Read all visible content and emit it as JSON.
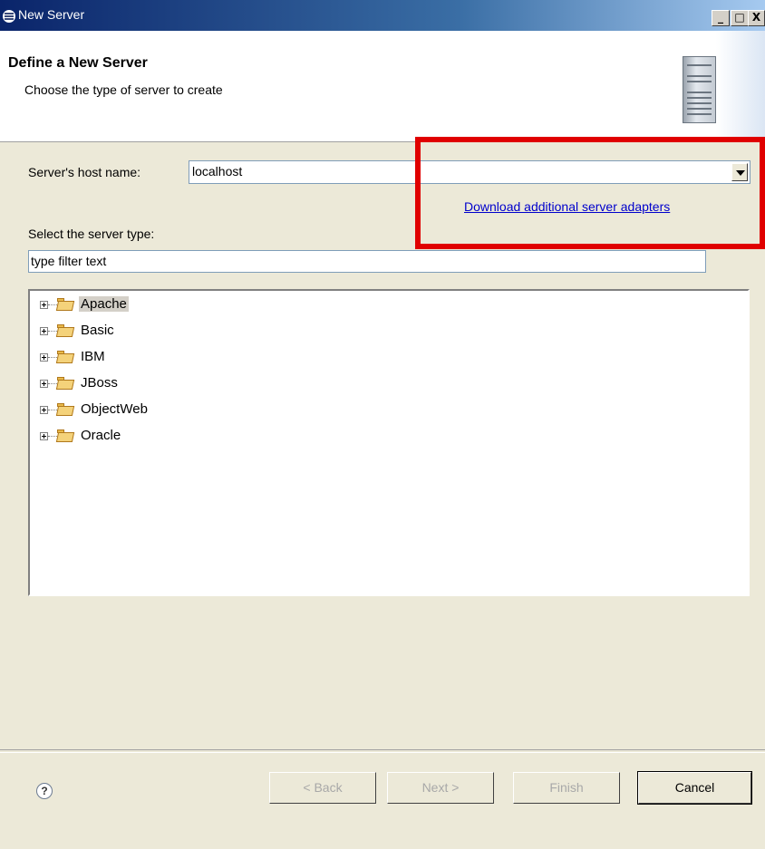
{
  "window": {
    "title": "New Server",
    "controls": {
      "minimize": "_",
      "maximize": "□",
      "close": "X"
    }
  },
  "header": {
    "title": "Define a New Server",
    "description": "Choose the type of server to create"
  },
  "form": {
    "host_label": "Server's host name:",
    "host_value": "localhost",
    "download_link": "Download additional server adapters",
    "server_type_label": "Select the server type:",
    "filter_value": "type filter text"
  },
  "tree": {
    "items": [
      {
        "label": "Apache",
        "selected": true
      },
      {
        "label": "Basic"
      },
      {
        "label": "IBM"
      },
      {
        "label": "JBoss"
      },
      {
        "label": "ObjectWeb"
      },
      {
        "label": "Oracle"
      }
    ]
  },
  "footer": {
    "help": "?",
    "back": "< Back",
    "next": "Next >",
    "finish": "Finish",
    "cancel": "Cancel"
  },
  "colors": {
    "highlight_box": "#e00000",
    "link": "#0000cc"
  }
}
